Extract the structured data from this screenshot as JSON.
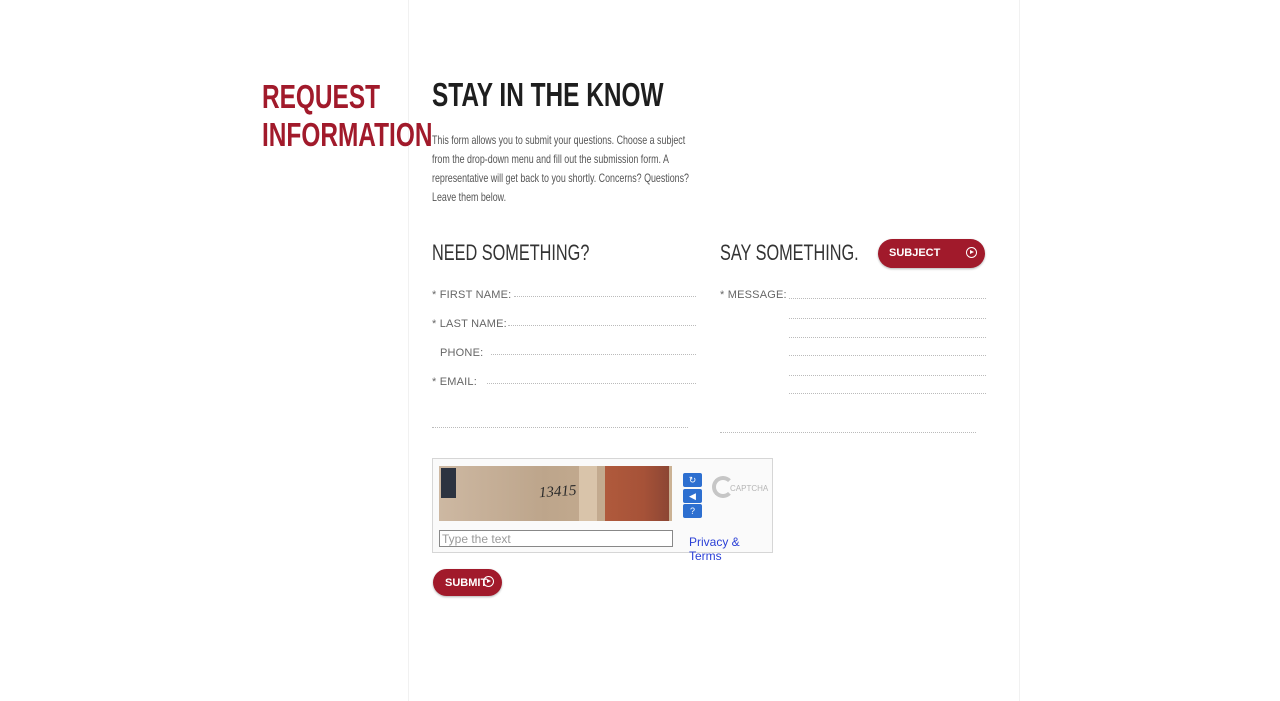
{
  "sidebar": {
    "title_line1": "REQUEST",
    "title_line2": "INFORMATION"
  },
  "main": {
    "title": "STAY IN THE KNOW",
    "intro": "This form allows you to submit your questions. Choose a subject from the drop-down menu and fill out the submission form. A representative will get back to you shortly. Concerns? Questions? Leave them below."
  },
  "contact": {
    "heading": "NEED SOMETHING?",
    "first_name_label": "* FIRST NAME:",
    "last_name_label": "* LAST NAME:",
    "phone_label": "PHONE:",
    "email_label": "* EMAIL:"
  },
  "message": {
    "heading": "SAY SOMETHING.",
    "subject_label": "SUBJECT",
    "message_label": "* MESSAGE:"
  },
  "captcha": {
    "image_text": "13415",
    "input_placeholder": "Type the text",
    "privacy_link": "Privacy & Terms",
    "brand": "CAPTCHA",
    "brand_prefix": "reCAPTCHA",
    "refresh_icon": "refresh-icon",
    "audio_icon": "audio-icon",
    "help_icon": "help-icon"
  },
  "submit_label": "SUBMIT",
  "colors": {
    "accent": "#a11a2b",
    "link": "#2a3fd6",
    "captcha_button": "#2d6fd0"
  }
}
